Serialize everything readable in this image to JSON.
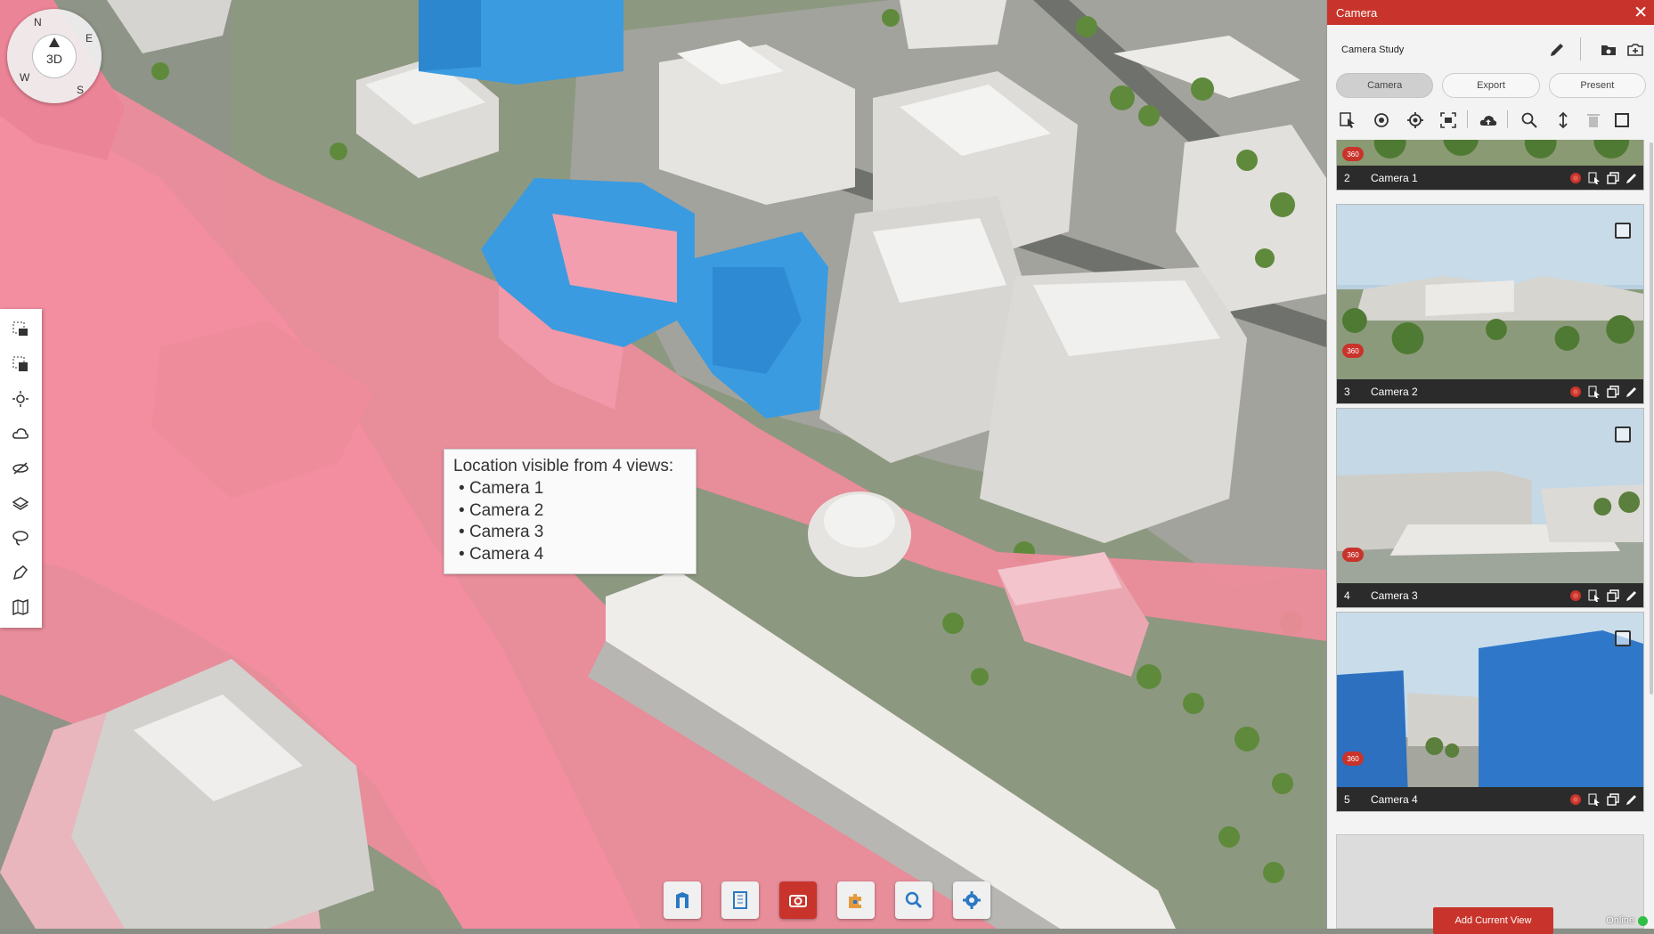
{
  "compass": {
    "mode": "3D",
    "n": "N",
    "e": "E",
    "s": "S",
    "w": "W"
  },
  "left_toolbar": [
    "area-camera-icon",
    "select-camera-icon",
    "sun-icon",
    "cloud-icon",
    "hide-view-icon",
    "layers-icon",
    "lasso-icon",
    "pen-icon",
    "map-icon"
  ],
  "tooltip": {
    "title": "Location visible from 4 views:",
    "items": [
      "Camera 1",
      "Camera 2",
      "Camera 3",
      "Camera 4"
    ],
    "bullet": "•"
  },
  "dock": [
    "building-icon",
    "document-icon",
    "camera-icon",
    "puzzle-icon",
    "search-icon",
    "settings-icon"
  ],
  "panel": {
    "title": "Camera",
    "close": "✕",
    "study_name": "Camera Study",
    "tabs": [
      "Camera",
      "Export",
      "Present"
    ],
    "active_tab": "Camera",
    "cards": [
      {
        "num": "2",
        "name": "Camera 1",
        "badge": "360"
      },
      {
        "num": "3",
        "name": "Camera 2",
        "badge": "360"
      },
      {
        "num": "4",
        "name": "Camera 3",
        "badge": "360"
      },
      {
        "num": "5",
        "name": "Camera 4",
        "badge": "360"
      }
    ],
    "add_button": "Add Current View",
    "status": "Online"
  },
  "colors": {
    "accent": "#c8342b",
    "highlight_pink": "#f08c9c",
    "building_blue": "#3a9be0",
    "online": "#2fbf45"
  }
}
